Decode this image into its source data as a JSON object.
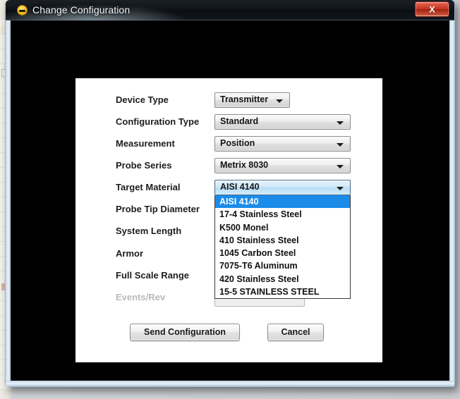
{
  "window": {
    "title": "Change Configuration",
    "icon": "minus-circle-icon",
    "close_label": "X"
  },
  "form": {
    "rows": [
      {
        "label": "Device Type",
        "value": "Transmitter",
        "control": "combo-narrow",
        "disabled": false
      },
      {
        "label": "Configuration Type",
        "value": "Standard",
        "control": "combo",
        "disabled": false
      },
      {
        "label": "Measurement",
        "value": "Position",
        "control": "combo",
        "disabled": false
      },
      {
        "label": "Probe Series",
        "value": "Metrix 8030",
        "control": "combo",
        "disabled": false
      },
      {
        "label": "Target Material",
        "value": "AISI 4140",
        "control": "combo-open",
        "disabled": false
      },
      {
        "label": "Probe Tip Diameter",
        "value": "",
        "control": "hidden",
        "disabled": false
      },
      {
        "label": "System Length",
        "value": "",
        "control": "hidden",
        "disabled": false
      },
      {
        "label": "Armor",
        "value": "",
        "control": "hidden",
        "disabled": false
      },
      {
        "label": "Full Scale Range",
        "value": "",
        "control": "hidden",
        "disabled": false
      },
      {
        "label": "Events/Rev",
        "value": "",
        "control": "text-input",
        "disabled": true
      }
    ]
  },
  "dropdown": {
    "open": true,
    "selected": "AISI 4140",
    "options": [
      "AISI 4140",
      "17-4 Stainless Steel",
      "K500 Monel",
      "410 Stainless Steel",
      "1045 Carbon Steel",
      "7075-T6 Aluminum",
      "420 Stainless Steel",
      "15-5 STAINLESS STEEL"
    ]
  },
  "buttons": {
    "send": "Send Configuration",
    "cancel": "Cancel"
  },
  "colors": {
    "highlight": "#1b8bea",
    "close_button": "#c23420",
    "panel": "#ffffff",
    "dialog_body": "#000000",
    "title_bar": "#12161b"
  }
}
